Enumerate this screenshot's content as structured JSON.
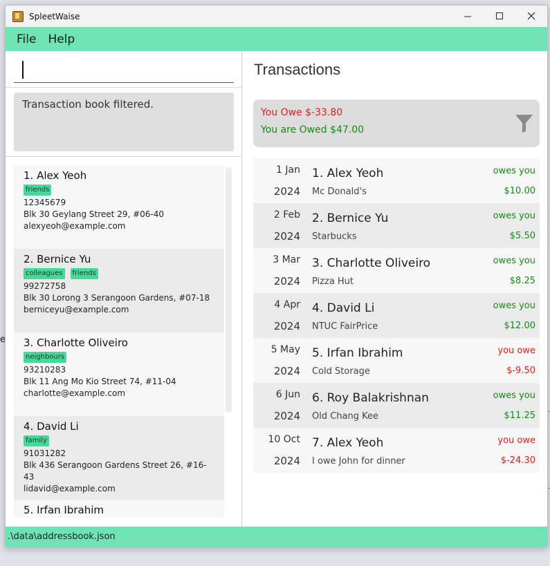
{
  "app": {
    "title": "SpleetWaise"
  },
  "window_controls": {
    "minimize": "—",
    "maximize": "☐",
    "close": "✕"
  },
  "menu": {
    "file": "File",
    "help": "Help"
  },
  "command": {
    "value": ""
  },
  "result": {
    "text": "Transaction book filtered."
  },
  "persons": [
    {
      "name": "1. Alex Yeoh",
      "tags": [
        "friends"
      ],
      "phone": "12345679",
      "address": "Blk 30 Geylang Street 29, #06-40",
      "email": "alexyeoh@example.com"
    },
    {
      "name": "2. Bernice Yu",
      "tags": [
        "colleagues",
        "friends"
      ],
      "phone": "99272758",
      "address": "Blk 30 Lorong 3 Serangoon Gardens, #07-18",
      "email": "berniceyu@example.com"
    },
    {
      "name": "3. Charlotte Oliveiro",
      "tags": [
        "neighbours"
      ],
      "phone": "93210283",
      "address": "Blk 11 Ang Mo Kio Street 74, #11-04",
      "email": "charlotte@example.com"
    },
    {
      "name": "4. David Li",
      "tags": [
        "family"
      ],
      "phone": "91031282",
      "address": "Blk 436 Serangoon Gardens Street 26, #16-43",
      "email": "lidavid@example.com"
    },
    {
      "name": "5. Irfan Ibrahim",
      "tags": [],
      "phone": "",
      "address": "",
      "email": ""
    }
  ],
  "transactions_panel": {
    "title": "Transactions",
    "summary": {
      "owe": "You Owe $-33.80",
      "owed": "You are Owed $47.00"
    },
    "colors": {
      "positive": "#138a13",
      "negative": "#e01b1b"
    },
    "icon": "filter-icon"
  },
  "transactions": [
    {
      "day": "1 Jan",
      "year": "2024",
      "name": "1. Alex Yeoh",
      "desc": "Mc Donald's",
      "status": "owes you",
      "amount": "$10.00",
      "kind": "green"
    },
    {
      "day": "2 Feb",
      "year": "2024",
      "name": "2. Bernice Yu",
      "desc": "Starbucks",
      "status": "owes you",
      "amount": "$5.50",
      "kind": "green"
    },
    {
      "day": "3 Mar",
      "year": "2024",
      "name": "3. Charlotte Oliveiro",
      "desc": "Pizza Hut",
      "status": "owes you",
      "amount": "$8.25",
      "kind": "green"
    },
    {
      "day": "4 Apr",
      "year": "2024",
      "name": "4. David Li",
      "desc": "NTUC FairPrice",
      "status": "owes you",
      "amount": "$12.00",
      "kind": "green"
    },
    {
      "day": "5 May",
      "year": "2024",
      "name": "5. Irfan Ibrahim",
      "desc": "Cold Storage",
      "status": "you owe",
      "amount": "$-9.50",
      "kind": "red"
    },
    {
      "day": "6 Jun",
      "year": "2024",
      "name": "6. Roy Balakrishnan",
      "desc": "Old Chang Kee",
      "status": "owes you",
      "amount": "$11.25",
      "kind": "green"
    },
    {
      "day": "10 Oct",
      "year": "2024",
      "name": "7. Alex Yeoh",
      "desc": "I owe John for dinner",
      "status": "you owe",
      "amount": "$-24.30",
      "kind": "red"
    }
  ],
  "status_bar": {
    "path": ".\\data\\addressbook.json"
  },
  "background": {
    "fragment": "e"
  }
}
